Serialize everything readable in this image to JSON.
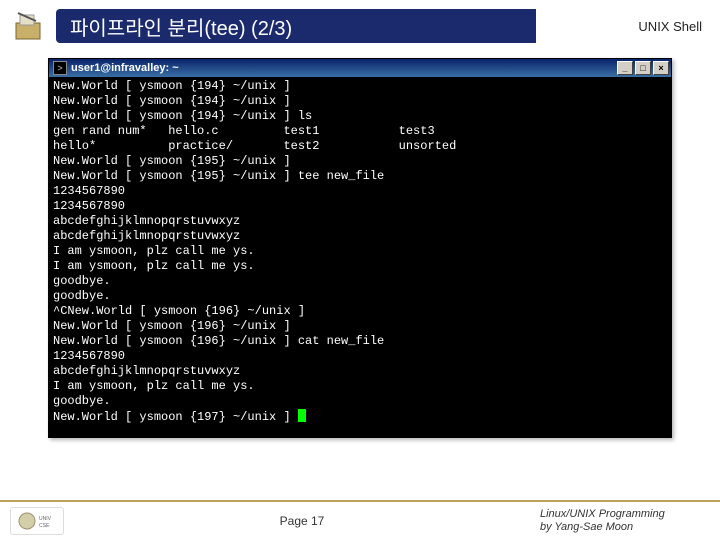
{
  "header": {
    "title": "파이프라인 분리(tee) (2/3)",
    "right_label": "UNIX Shell"
  },
  "terminal": {
    "title": "user1@infravalley: ~",
    "lines": [
      "New.World [ ysmoon {194} ~/unix ]",
      "New.World [ ysmoon {194} ~/unix ]",
      "New.World [ ysmoon {194} ~/unix ] ls",
      "gen rand num*   hello.c         test1           test3",
      "hello*          practice/       test2           unsorted",
      "New.World [ ysmoon {195} ~/unix ]",
      "New.World [ ysmoon {195} ~/unix ] tee new_file",
      "1234567890",
      "1234567890",
      "abcdefghijklmnopqrstuvwxyz",
      "abcdefghijklmnopqrstuvwxyz",
      "I am ysmoon, plz call me ys.",
      "I am ysmoon, plz call me ys.",
      "goodbye.",
      "goodbye.",
      "^CNew.World [ ysmoon {196} ~/unix ]",
      "New.World [ ysmoon {196} ~/unix ]",
      "New.World [ ysmoon {196} ~/unix ] cat new_file",
      "1234567890",
      "abcdefghijklmnopqrstuvwxyz",
      "I am ysmoon, plz call me ys.",
      "goodbye.",
      "New.World [ ysmoon {197} ~/unix ] "
    ]
  },
  "footer": {
    "page": "Page 17",
    "credit_line1": "Linux/UNIX Programming",
    "credit_line2": "by Yang-Sae Moon"
  },
  "win_buttons": {
    "min": "_",
    "max": "□",
    "close": "×"
  }
}
